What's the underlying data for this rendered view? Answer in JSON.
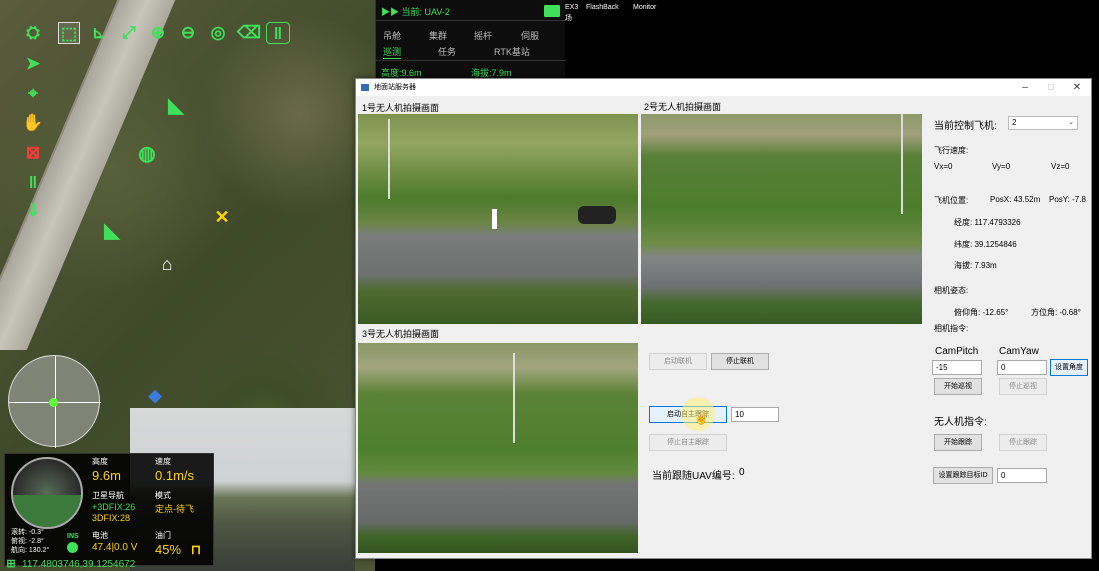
{
  "top_labels": {
    "ex3": "EX3",
    "flashback": "FlashBack",
    "monitor": "Monitor",
    "fragment": "场"
  },
  "map": {
    "coordinates": "117.4803746,39.1254672",
    "telemetry": {
      "altitude_label": "高度",
      "altitude_value": "9.6m",
      "speed_label": "速度",
      "speed_value": "0.1m/s",
      "gnss_label": "卫星导航",
      "gnss_value1": "+3DFIX:26",
      "gnss_value2": "3DFIX:28",
      "mode_label": "模式",
      "mode_value": "定点-待飞",
      "battery_label": "电池",
      "battery_value": "47.4|0.0 V",
      "throttle_label": "油门",
      "throttle_value": "45%",
      "roll_label": "滚转:",
      "roll_value": "-0.3°",
      "pitch_label": "俯视:",
      "pitch_value": "-2.8°",
      "heading_label": "航向:",
      "heading_value": "130.2°",
      "ins_label": "INS"
    },
    "toolbar_icons": [
      "drone-icon",
      "select-icon",
      "ruler-icon",
      "fit-icon",
      "zoom-in-icon",
      "zoom-out-icon",
      "target-icon",
      "eraser-icon",
      "pause-group-icon"
    ],
    "side_icons": [
      "navigate-icon",
      "location-pin-icon",
      "hand-icon",
      "lock-icon",
      "pause-icon",
      "land-icon"
    ]
  },
  "uav_panel": {
    "current": "▶▶ 当前:  UAV-2",
    "tabs_row1": [
      "吊舱",
      "集群",
      "摇杆",
      "伺服"
    ],
    "tabs_row2": [
      "巡测",
      "任务",
      "RTK基站"
    ],
    "active_tab": "巡测",
    "altitude": "高度:9.6m",
    "sea_altitude": "海拔:7.9m"
  },
  "dialog": {
    "title": "地面站服务器",
    "feed1_title": "1号无人机拍摄画面",
    "feed2_title": "2号无人机拍摄画面",
    "feed3_title": "3号无人机拍摄画面",
    "start_link": "启动联机",
    "stop_link": "停止联机",
    "start_auto_track": "启动自主跟踪",
    "auto_track_value": "10",
    "stop_auto_track": "停止自主跟踪",
    "current_follow_label": "当前跟随UAV编号:",
    "current_follow_value": "0",
    "control_label": "当前控制飞机:",
    "control_value": "2",
    "flight_speed_label": "飞行速度:",
    "vx": "Vx=0",
    "vy": "Vy=0",
    "vz": "Vz=0",
    "position_label": "飞机位置:",
    "posx": "PosX: 43.52m",
    "posy": "PosY: -7.8",
    "longitude": "经度: 117.4793326",
    "latitude": "纬度: 39.1254846",
    "altitude": "海拔: 7.93m",
    "camera_attitude_label": "相机姿态:",
    "pitch": "俯仰角: -12.65°",
    "yaw": "方位角: -0.68°",
    "camera_command_label": "相机指令:",
    "campitch_label": "CamPitch",
    "camyaw_label": "CamYaw",
    "campitch_value": "-15",
    "camyaw_value": "0",
    "set_angle": "设置角度",
    "start_patrol": "开始巡视",
    "stop_patrol": "停止巡视",
    "uav_command_label": "无人机指令:",
    "start_track": "开始跟踪",
    "stop_track": "停止跟踪",
    "set_target_id": "设置跟踪目标ID",
    "target_id_value": "0"
  },
  "colors": {
    "accent": "#3fe05a",
    "warning": "#ff3a3a",
    "highlight": "#ffd400"
  }
}
